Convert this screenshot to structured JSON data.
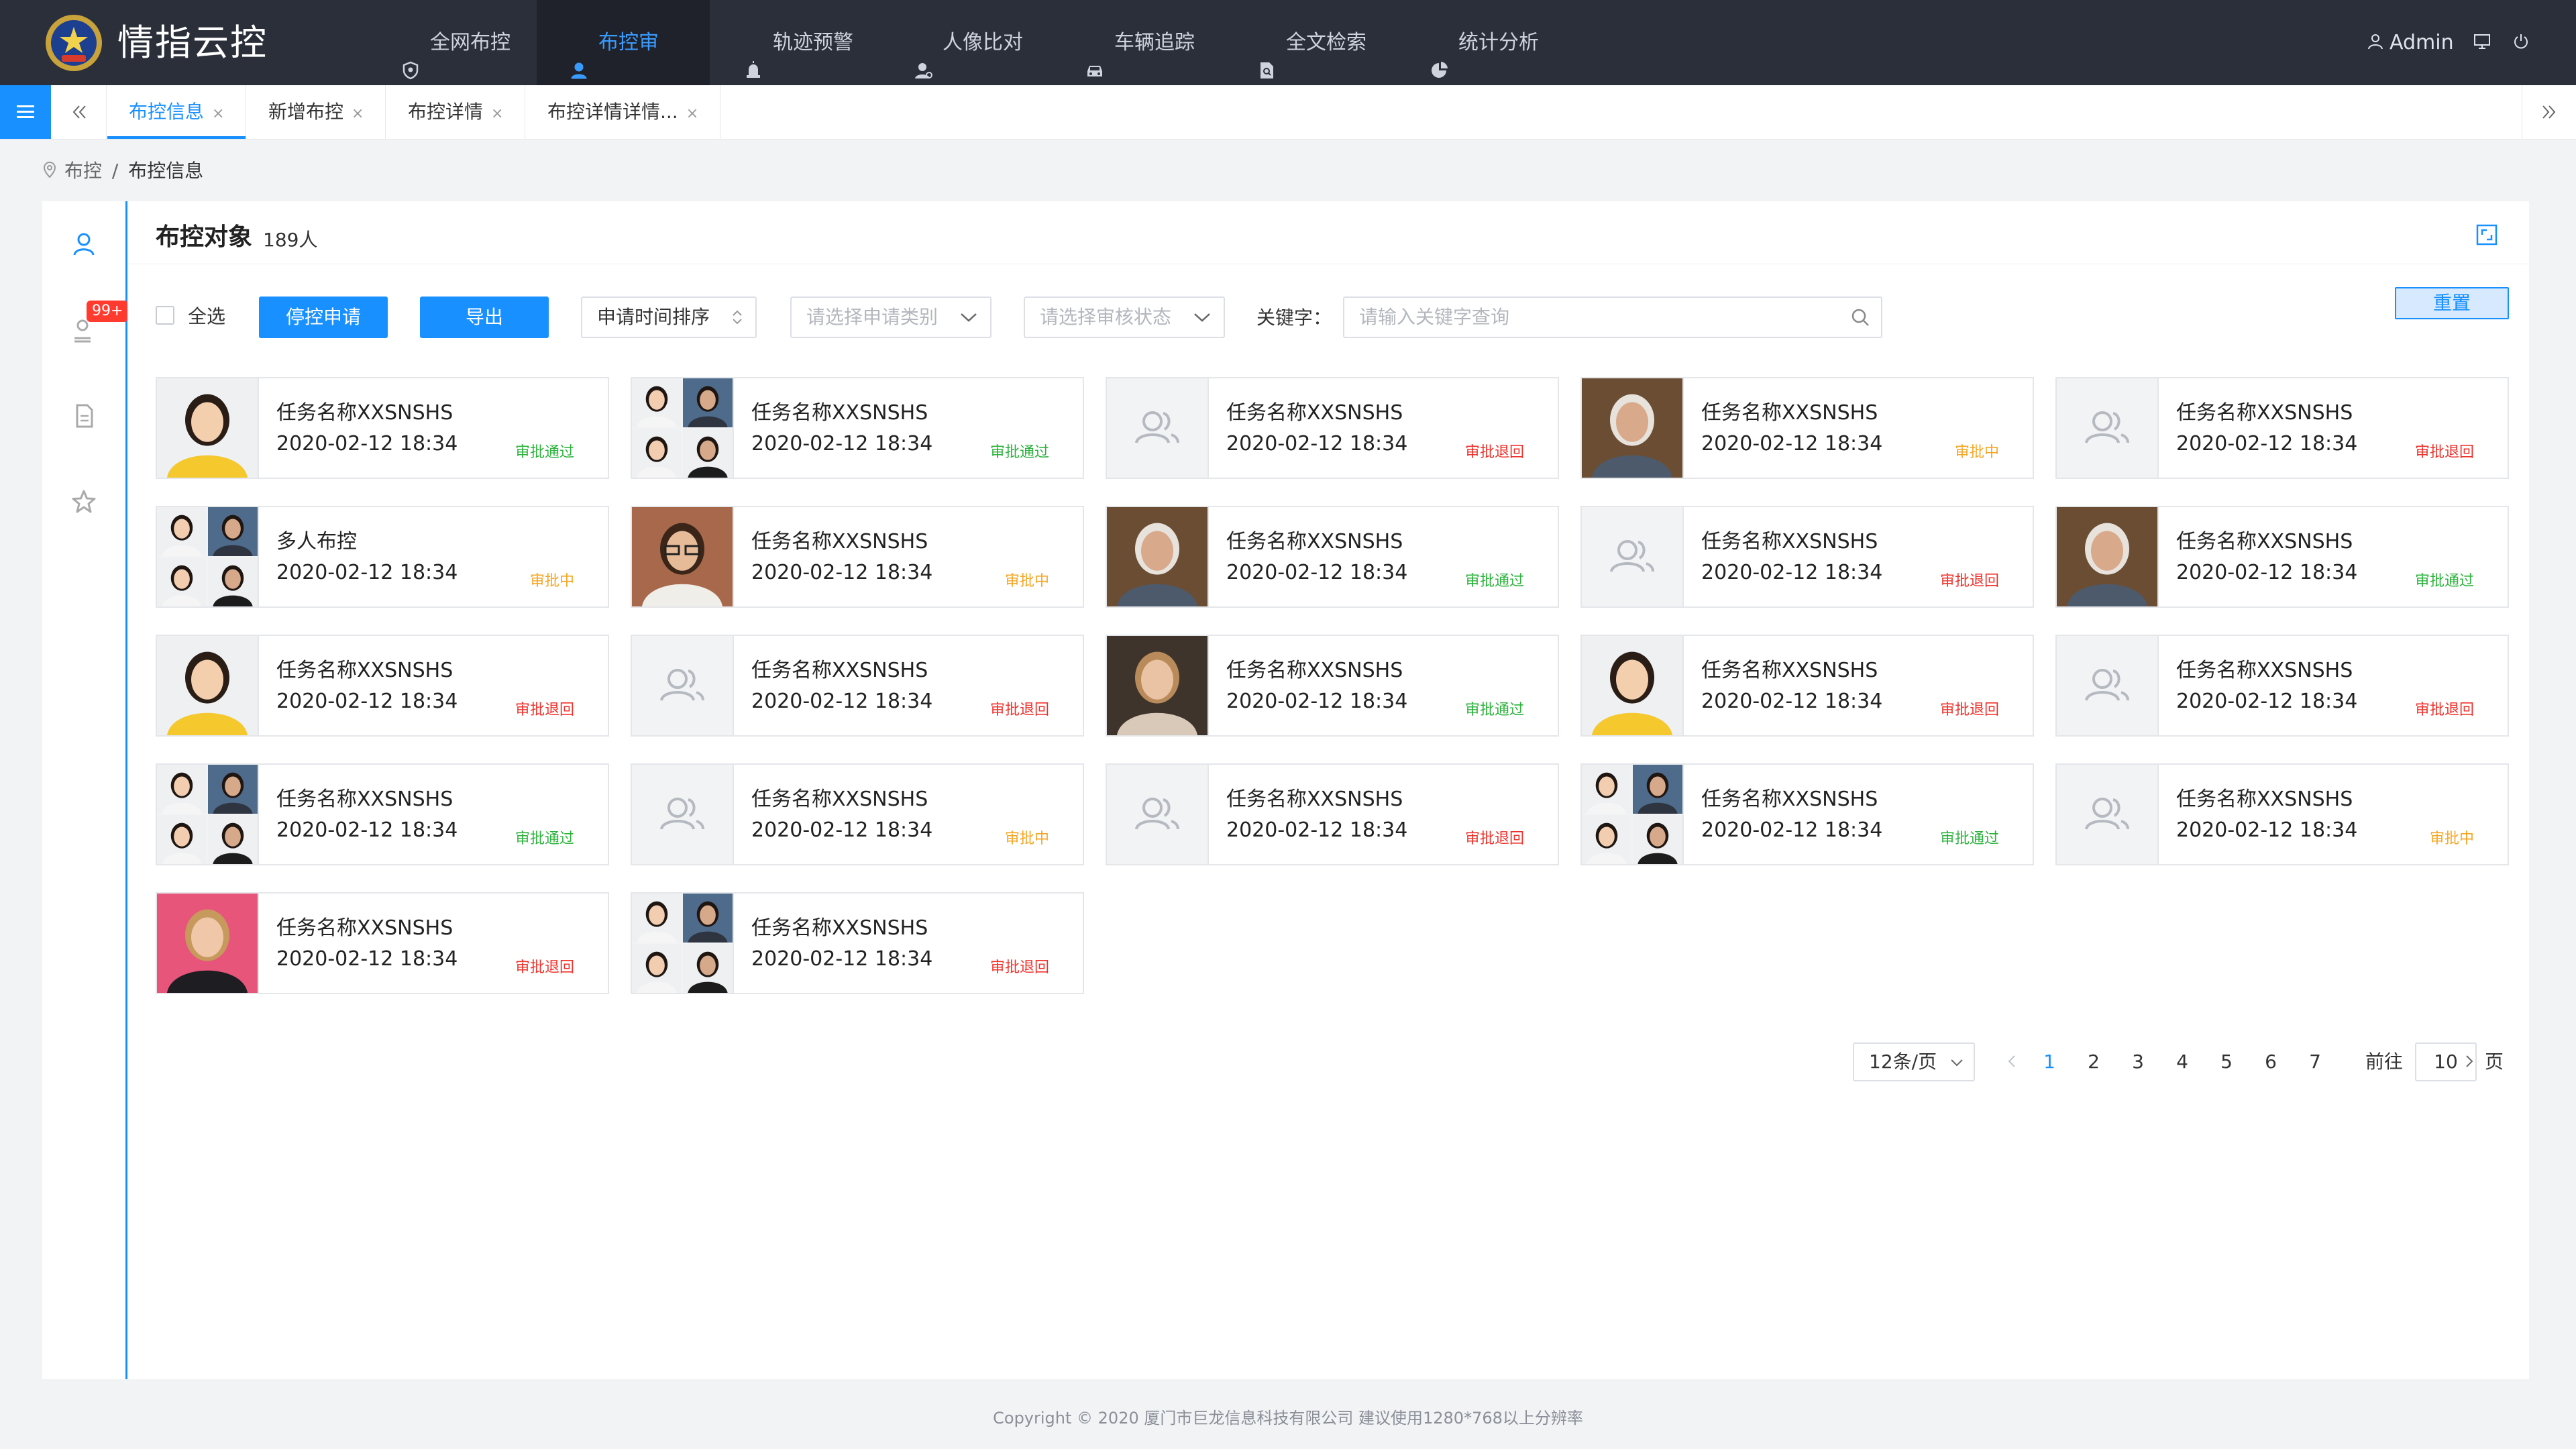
{
  "app": {
    "brand": "情指云控"
  },
  "nav": {
    "items": [
      {
        "label": "全网布控",
        "icon": "shield-icon",
        "active": false
      },
      {
        "label": "布控审批",
        "icon": "user-icon",
        "active": true
      },
      {
        "label": "轨迹预警",
        "icon": "alarm-icon",
        "active": false
      },
      {
        "label": "人像比对",
        "icon": "portrait-icon",
        "active": false
      },
      {
        "label": "车辆追踪",
        "icon": "car-icon",
        "active": false
      },
      {
        "label": "全文检索",
        "icon": "doc-search-icon",
        "active": false
      },
      {
        "label": "统计分析",
        "icon": "pie-chart-icon",
        "active": false
      }
    ],
    "user": "Admin"
  },
  "tabs": [
    {
      "label": "布控信息",
      "active": true
    },
    {
      "label": "新增布控",
      "active": false
    },
    {
      "label": "布控详情",
      "active": false
    },
    {
      "label": "布控详情详情...",
      "active": false
    }
  ],
  "breadcrumb": {
    "parent": "布控",
    "separator": "/",
    "current": "布控信息"
  },
  "rail": {
    "badge": "99+"
  },
  "panel": {
    "title": "布控对象",
    "count": "189人"
  },
  "toolbar": {
    "select_all": "全选",
    "stop_apply": "停控申请",
    "export": "导出",
    "sort": "申请时间排序",
    "type_placeholder": "请选择申请类别",
    "status_placeholder": "请选择审核状态",
    "keyword_label": "关键字：",
    "keyword_placeholder": "请输入关键字查询",
    "reset": "重置"
  },
  "cards": [
    {
      "title": "任务名称XXSNSHS",
      "time": "2020-02-12  18:34",
      "status": "审批通过",
      "state": "pass",
      "thumb": "single-woman"
    },
    {
      "title": "任务名称XXSNSHS",
      "time": "2020-02-12  18:34",
      "status": "审批通过",
      "state": "pass",
      "thumb": "multi"
    },
    {
      "title": "任务名称XXSNSHS",
      "time": "2020-02-12  18:34",
      "status": "审批退回",
      "state": "back",
      "thumb": "placeholder"
    },
    {
      "title": "任务名称XXSNSHS",
      "time": "2020-02-12  18:34",
      "status": "审批中",
      "state": "wait",
      "thumb": "old-man"
    },
    {
      "title": "任务名称XXSNSHS",
      "time": "2020-02-12  18:34",
      "status": "审批退回",
      "state": "back",
      "thumb": "placeholder"
    },
    {
      "title": "多人布控",
      "time": "2020-02-12  18:34",
      "status": "审批中",
      "state": "wait",
      "thumb": "multi"
    },
    {
      "title": "任务名称XXSNSHS",
      "time": "2020-02-12  18:34",
      "status": "审批中",
      "state": "wait",
      "thumb": "glasses-man"
    },
    {
      "title": "任务名称XXSNSHS",
      "time": "2020-02-12  18:34",
      "status": "审批通过",
      "state": "pass",
      "thumb": "old-man"
    },
    {
      "title": "任务名称XXSNSHS",
      "time": "2020-02-12  18:34",
      "status": "审批退回",
      "state": "back",
      "thumb": "placeholder"
    },
    {
      "title": "任务名称XXSNSHS",
      "time": "2020-02-12  18:34",
      "status": "审批通过",
      "state": "pass",
      "thumb": "old-man"
    },
    {
      "title": "任务名称XXSNSHS",
      "time": "2020-02-12  18:34",
      "status": "审批退回",
      "state": "back",
      "thumb": "single-woman"
    },
    {
      "title": "任务名称XXSNSHS",
      "time": "2020-02-12  18:34",
      "status": "审批退回",
      "state": "back",
      "thumb": "placeholder"
    },
    {
      "title": "任务名称XXSNSHS",
      "time": "2020-02-12  18:34",
      "status": "审批通过",
      "state": "pass",
      "thumb": "laughing-woman"
    },
    {
      "title": "任务名称XXSNSHS",
      "time": "2020-02-12  18:34",
      "status": "审批退回",
      "state": "back",
      "thumb": "single-woman"
    },
    {
      "title": "任务名称XXSNSHS",
      "time": "2020-02-12  18:34",
      "status": "审批退回",
      "state": "back",
      "thumb": "placeholder"
    },
    {
      "title": "任务名称XXSNSHS",
      "time": "2020-02-12  18:34",
      "status": "审批通过",
      "state": "pass",
      "thumb": "multi"
    },
    {
      "title": "任务名称XXSNSHS",
      "time": "2020-02-12  18:34",
      "status": "审批中",
      "state": "wait",
      "thumb": "placeholder"
    },
    {
      "title": "任务名称XXSNSHS",
      "time": "2020-02-12  18:34",
      "status": "审批退回",
      "state": "back",
      "thumb": "placeholder"
    },
    {
      "title": "任务名称XXSNSHS",
      "time": "2020-02-12  18:34",
      "status": "审批通过",
      "state": "pass",
      "thumb": "multi"
    },
    {
      "title": "任务名称XXSNSHS",
      "time": "2020-02-12  18:34",
      "status": "审批中",
      "state": "wait",
      "thumb": "placeholder"
    },
    {
      "title": "任务名称XXSNSHS",
      "time": "2020-02-12  18:34",
      "status": "审批退回",
      "state": "back",
      "thumb": "pink-woman"
    },
    {
      "title": "任务名称XXSNSHS",
      "time": "2020-02-12  18:34",
      "status": "审批退回",
      "state": "back",
      "thumb": "multi"
    }
  ],
  "pagination": {
    "page_size": "12条/页",
    "pages": [
      "1",
      "2",
      "3",
      "4",
      "5",
      "6",
      "7"
    ],
    "current": "1",
    "goto_label": "前往",
    "goto_value": "10",
    "page_suffix": "页"
  },
  "footer": {
    "text": "Copyright © 2020  厦门市巨龙信息科技有限公司  建议使用1280*768以上分辨率"
  },
  "colors": {
    "nav_bg": "#2b2f3a",
    "accent": "#1890ff",
    "pass": "#2bb33b",
    "back": "#f0312b",
    "wait": "#f5a623"
  }
}
